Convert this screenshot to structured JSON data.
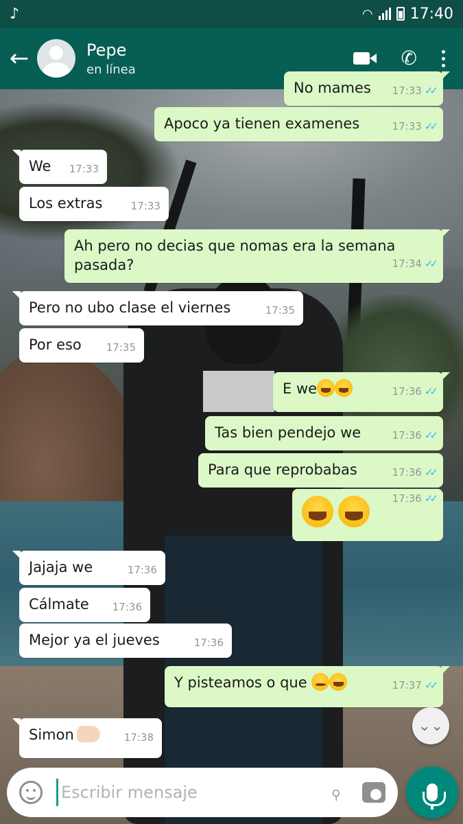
{
  "status_bar": {
    "left_icon": "music-note-icon",
    "left_glyph": "♪",
    "time": "17:40"
  },
  "header": {
    "contact_name": "Pepe",
    "presence": "en línea",
    "back_glyph": "←",
    "phone_glyph": "✆"
  },
  "messages": [
    {
      "dir": "out",
      "text": "No mames",
      "time": "17:33",
      "ticks": "✓✓"
    },
    {
      "dir": "out",
      "text": "Apoco ya tienen examenes",
      "time": "17:33",
      "ticks": "✓✓"
    },
    {
      "dir": "in",
      "text": "We",
      "time": "17:33"
    },
    {
      "dir": "in",
      "text": "Los extras",
      "time": "17:33"
    },
    {
      "dir": "out",
      "text": "Ah pero no decias que nomas era la semana pasada?",
      "time": "17:34",
      "ticks": "✓✓"
    },
    {
      "dir": "in",
      "text": "Pero no ubo clase el viernes",
      "time": "17:35"
    },
    {
      "dir": "in",
      "text": "Por eso",
      "time": "17:35"
    },
    {
      "dir": "out",
      "text": "E we",
      "time": "17:36",
      "ticks": "✓✓",
      "emojis": [
        "joy-emoji",
        "joy-emoji"
      ]
    },
    {
      "dir": "out",
      "text": "Tas bien pendejo we",
      "time": "17:36",
      "ticks": "✓✓"
    },
    {
      "dir": "out",
      "text": "Para que reprobabas",
      "time": "17:36",
      "ticks": "✓✓"
    },
    {
      "dir": "out",
      "text": "",
      "time": "17:36",
      "ticks": "✓✓",
      "emojis": [
        "joy-emoji",
        "joy-emoji"
      ]
    },
    {
      "dir": "in",
      "text": "Jajaja we",
      "time": "17:36"
    },
    {
      "dir": "in",
      "text": "Cálmate",
      "time": "17:36"
    },
    {
      "dir": "in",
      "text": "Mejor ya el jueves",
      "time": "17:36"
    },
    {
      "dir": "out",
      "text": "Y pisteamos o que",
      "time": "17:37",
      "ticks": "✓✓",
      "emojis": [
        "drooling-emoji",
        "joy-emoji"
      ]
    },
    {
      "dir": "in",
      "text": "Simon",
      "time": "17:38",
      "emojis": [
        "call-me-hand-emoji"
      ]
    }
  ],
  "scroll_button": {
    "glyph": "⌄⌄"
  },
  "composer": {
    "placeholder": "Escribir mensaje",
    "value": "",
    "attach_glyph": "⌀"
  },
  "colors": {
    "status_bar": "#0e4e47",
    "header": "#075e54",
    "outgoing": "#dcf8c6",
    "incoming": "#ffffff",
    "read_ticks": "#34b7f1",
    "mic_button": "#00897b"
  }
}
